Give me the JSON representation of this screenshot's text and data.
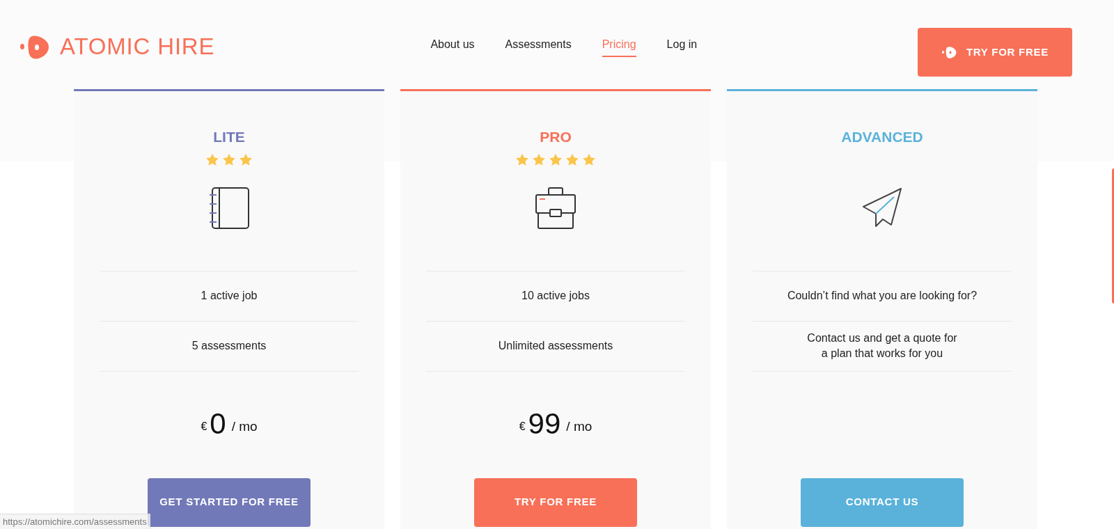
{
  "header": {
    "brand": "ATOMIC HIRE",
    "nav": [
      {
        "label": "About us",
        "selected": false
      },
      {
        "label": "Assessments",
        "selected": false
      },
      {
        "label": "Pricing",
        "selected": true
      },
      {
        "label": "Log in",
        "selected": false
      }
    ],
    "cta": "TRY FOR FREE"
  },
  "plans": [
    {
      "name": "LITE",
      "color": "#7279b8",
      "stars": 3,
      "features": [
        "1 active job",
        "5 assessments"
      ],
      "price": {
        "currency": "€",
        "amount": "0",
        "period": "/ mo"
      },
      "button": "GET STARTED FOR FREE"
    },
    {
      "name": "PRO",
      "color": "#f87058",
      "stars": 5,
      "features": [
        "10 active jobs",
        "Unlimited assessments"
      ],
      "price": {
        "currency": "€",
        "amount": "99",
        "period": "/ mo"
      },
      "button": "TRY FOR FREE"
    },
    {
      "name": "ADVANCED",
      "color": "#5ab2da",
      "features": [
        "Couldn’t find what you are looking for?",
        "Contact us and get a quote for\na plan that works for you"
      ],
      "button": "CONTACT US"
    }
  ],
  "status_url": "https://atomichire.com/assessments"
}
